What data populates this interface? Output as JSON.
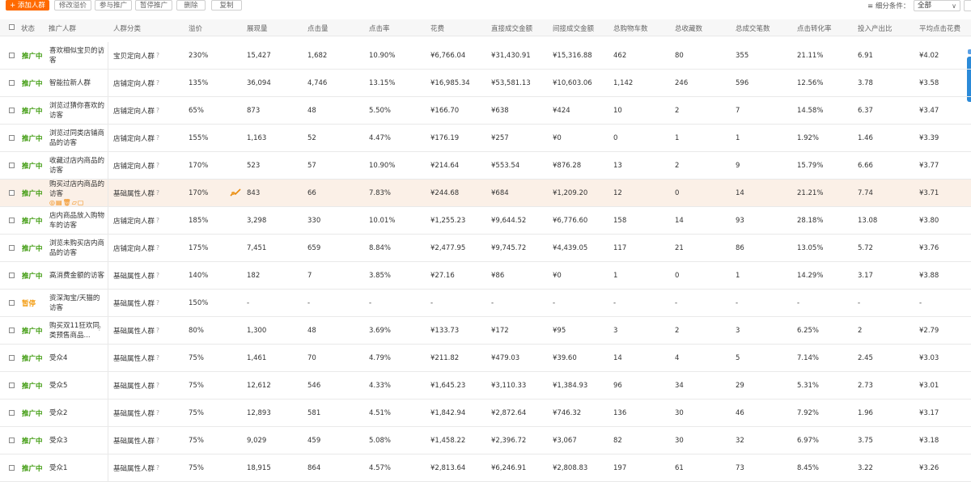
{
  "toolbar": {
    "add_label": "+ 添加人群",
    "modify_bid_label": "修改溢价",
    "join_label": "参与推广",
    "pause_label": "暂停推广",
    "delete_label": "删除",
    "copy_label": "复制",
    "filter_label": "≡ 细分条件：",
    "filter_value": "全部"
  },
  "columns": {
    "select_all": "",
    "status": "状态",
    "name": "推广人群",
    "category": "人群分类",
    "premium": "溢价",
    "impressions": "展现量",
    "clicks": "点击量",
    "ctr": "点击率",
    "cost": "花费",
    "direct_gmv": "直接成交金额",
    "indirect_gmv": "间接成交金额",
    "cart": "总购物车数",
    "fav": "总收藏数",
    "orders": "总成交笔数",
    "cvr": "点击转化率",
    "roi": "投入产出比",
    "cpc": "平均点击花费"
  },
  "rows": [
    {
      "status": "推广中",
      "status_type": "on",
      "name": "喜欢相似宝贝的访客",
      "category": "宝贝定向人群",
      "premium": "230%",
      "impressions": "15,427",
      "clicks": "1,682",
      "ctr": "10.90%",
      "cost": "¥6,766.04",
      "direct": "¥31,430.91",
      "indirect": "¥15,316.88",
      "cart": "462",
      "fav": "80",
      "orders": "355",
      "cvr": "21.11%",
      "roi": "6.91",
      "cpc": "¥4.02"
    },
    {
      "status": "推广中",
      "status_type": "on",
      "name": "智能拉新人群",
      "category": "店铺定向人群",
      "premium": "135%",
      "impressions": "36,094",
      "clicks": "4,746",
      "ctr": "13.15%",
      "cost": "¥16,985.34",
      "direct": "¥53,581.13",
      "indirect": "¥10,603.06",
      "cart": "1,142",
      "fav": "246",
      "orders": "596",
      "cvr": "12.56%",
      "roi": "3.78",
      "cpc": "¥3.58"
    },
    {
      "status": "推广中",
      "status_type": "on",
      "name": "浏览过猜你喜欢的访客",
      "category": "店铺定向人群",
      "premium": "65%",
      "impressions": "873",
      "clicks": "48",
      "ctr": "5.50%",
      "cost": "¥166.70",
      "direct": "¥638",
      "indirect": "¥424",
      "cart": "10",
      "fav": "2",
      "orders": "7",
      "cvr": "14.58%",
      "roi": "6.37",
      "cpc": "¥3.47"
    },
    {
      "status": "推广中",
      "status_type": "on",
      "name": "浏览过同类店铺商品的访客",
      "category": "店铺定向人群",
      "premium": "155%",
      "impressions": "1,163",
      "clicks": "52",
      "ctr": "4.47%",
      "cost": "¥176.19",
      "direct": "¥257",
      "indirect": "¥0",
      "cart": "0",
      "fav": "1",
      "orders": "1",
      "cvr": "1.92%",
      "roi": "1.46",
      "cpc": "¥3.39"
    },
    {
      "status": "推广中",
      "status_type": "on",
      "name": "收藏过店内商品的访客",
      "category": "店铺定向人群",
      "premium": "170%",
      "impressions": "523",
      "clicks": "57",
      "ctr": "10.90%",
      "cost": "¥214.64",
      "direct": "¥553.54",
      "indirect": "¥876.28",
      "cart": "13",
      "fav": "2",
      "orders": "9",
      "cvr": "15.79%",
      "roi": "6.66",
      "cpc": "¥3.77"
    },
    {
      "status": "推广中",
      "status_type": "on",
      "name": "购买过店内商品的访客",
      "category": "基础属性人群",
      "premium": "170%",
      "impressions": "843",
      "clicks": "66",
      "ctr": "7.83%",
      "cost": "¥244.68",
      "direct": "¥684",
      "indirect": "¥1,209.20",
      "cart": "12",
      "fav": "0",
      "orders": "14",
      "cvr": "21.21%",
      "roi": "7.74",
      "cpc": "¥3.71"
    },
    {
      "status": "推广中",
      "status_type": "on",
      "name": "店内商品放入购物车的访客",
      "category": "店铺定向人群",
      "premium": "185%",
      "impressions": "3,298",
      "clicks": "330",
      "ctr": "10.01%",
      "cost": "¥1,255.23",
      "direct": "¥9,644.52",
      "indirect": "¥6,776.60",
      "cart": "158",
      "fav": "14",
      "orders": "93",
      "cvr": "28.18%",
      "roi": "13.08",
      "cpc": "¥3.80"
    },
    {
      "status": "推广中",
      "status_type": "on",
      "name": "浏览未购买店内商品的访客",
      "category": "店铺定向人群",
      "premium": "175%",
      "impressions": "7,451",
      "clicks": "659",
      "ctr": "8.84%",
      "cost": "¥2,477.95",
      "direct": "¥9,745.72",
      "indirect": "¥4,439.05",
      "cart": "117",
      "fav": "21",
      "orders": "86",
      "cvr": "13.05%",
      "roi": "5.72",
      "cpc": "¥3.76"
    },
    {
      "status": "推广中",
      "status_type": "on",
      "name": "高消费金额的访客",
      "category": "基础属性人群",
      "premium": "140%",
      "impressions": "182",
      "clicks": "7",
      "ctr": "3.85%",
      "cost": "¥27.16",
      "direct": "¥86",
      "indirect": "¥0",
      "cart": "1",
      "fav": "0",
      "orders": "1",
      "cvr": "14.29%",
      "roi": "3.17",
      "cpc": "¥3.88"
    },
    {
      "status": "暂停",
      "status_type": "off",
      "name": "资深淘宝/天猫的访客",
      "category": "基础属性人群",
      "premium": "150%",
      "impressions": "-",
      "clicks": "-",
      "ctr": "-",
      "cost": "-",
      "direct": "-",
      "indirect": "-",
      "cart": "-",
      "fav": "-",
      "orders": "-",
      "cvr": "-",
      "roi": "-",
      "cpc": "-"
    },
    {
      "status": "推广中",
      "status_type": "on",
      "name": "购买双11狂欢同类预售商品...",
      "category": "基础属性人群",
      "premium": "80%",
      "impressions": "1,300",
      "clicks": "48",
      "ctr": "3.69%",
      "cost": "¥133.73",
      "direct": "¥172",
      "indirect": "¥95",
      "cart": "3",
      "fav": "2",
      "orders": "3",
      "cvr": "6.25%",
      "roi": "2",
      "cpc": "¥2.79"
    },
    {
      "status": "推广中",
      "status_type": "on",
      "name": "受众4",
      "category": "基础属性人群",
      "premium": "75%",
      "impressions": "1,461",
      "clicks": "70",
      "ctr": "4.79%",
      "cost": "¥211.82",
      "direct": "¥479.03",
      "indirect": "¥39.60",
      "cart": "14",
      "fav": "4",
      "orders": "5",
      "cvr": "7.14%",
      "roi": "2.45",
      "cpc": "¥3.03"
    },
    {
      "status": "推广中",
      "status_type": "on",
      "name": "受众5",
      "category": "基础属性人群",
      "premium": "75%",
      "impressions": "12,612",
      "clicks": "546",
      "ctr": "4.33%",
      "cost": "¥1,645.23",
      "direct": "¥3,110.33",
      "indirect": "¥1,384.93",
      "cart": "96",
      "fav": "34",
      "orders": "29",
      "cvr": "5.31%",
      "roi": "2.73",
      "cpc": "¥3.01"
    },
    {
      "status": "推广中",
      "status_type": "on",
      "name": "受众2",
      "category": "基础属性人群",
      "premium": "75%",
      "impressions": "12,893",
      "clicks": "581",
      "ctr": "4.51%",
      "cost": "¥1,842.94",
      "direct": "¥2,872.64",
      "indirect": "¥746.32",
      "cart": "136",
      "fav": "30",
      "orders": "46",
      "cvr": "7.92%",
      "roi": "1.96",
      "cpc": "¥3.17"
    },
    {
      "status": "推广中",
      "status_type": "on",
      "name": "受众3",
      "category": "基础属性人群",
      "premium": "75%",
      "impressions": "9,029",
      "clicks": "459",
      "ctr": "5.08%",
      "cost": "¥1,458.22",
      "direct": "¥2,396.72",
      "indirect": "¥3,067",
      "cart": "82",
      "fav": "30",
      "orders": "32",
      "cvr": "6.97%",
      "roi": "3.75",
      "cpc": "¥3.18"
    },
    {
      "status": "推广中",
      "status_type": "on",
      "name": "受众1",
      "category": "基础属性人群",
      "premium": "75%",
      "impressions": "18,915",
      "clicks": "864",
      "ctr": "4.57%",
      "cost": "¥2,813.64",
      "direct": "¥6,246.91",
      "indirect": "¥2,808.83",
      "cart": "197",
      "fav": "61",
      "orders": "73",
      "cvr": "8.45%",
      "roi": "3.22",
      "cpc": "¥3.26"
    }
  ],
  "row_tools": "◎▤🗑▱▢",
  "qmark": "?"
}
